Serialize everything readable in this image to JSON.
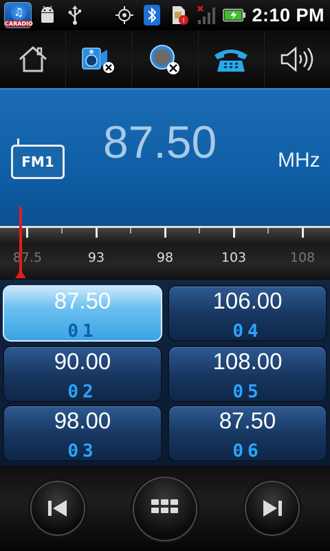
{
  "status_bar": {
    "app_icon_label": "CARADIO",
    "time": "2:10 PM"
  },
  "toolbar": {
    "buttons": [
      {
        "icon": "home-icon"
      },
      {
        "icon": "speaker-mute-icon"
      },
      {
        "icon": "record-off-icon"
      },
      {
        "icon": "telephone-icon"
      },
      {
        "icon": "volume-icon"
      }
    ]
  },
  "display": {
    "band": "FM1",
    "frequency": "87.50",
    "unit": "MHz"
  },
  "dial": {
    "labels": [
      "87.5",
      "93",
      "98",
      "103",
      "108"
    ],
    "current_value": 87.5
  },
  "presets": [
    {
      "frequency": "87.50",
      "number": "01",
      "active": true
    },
    {
      "frequency": "106.00",
      "number": "04",
      "active": false
    },
    {
      "frequency": "90.00",
      "number": "02",
      "active": false
    },
    {
      "frequency": "108.00",
      "number": "05",
      "active": false
    },
    {
      "frequency": "98.00",
      "number": "03",
      "active": false
    },
    {
      "frequency": "87.50",
      "number": "06",
      "active": false
    }
  ],
  "controls": {
    "prev": "skip-previous-icon",
    "menu": "grid-menu-icon",
    "next": "skip-next-icon"
  },
  "colors": {
    "display_bg": "#0f5ea6",
    "preset_active": "#6cbff0",
    "preset_number": "#2aa4ff",
    "needle": "#e21d1d"
  }
}
